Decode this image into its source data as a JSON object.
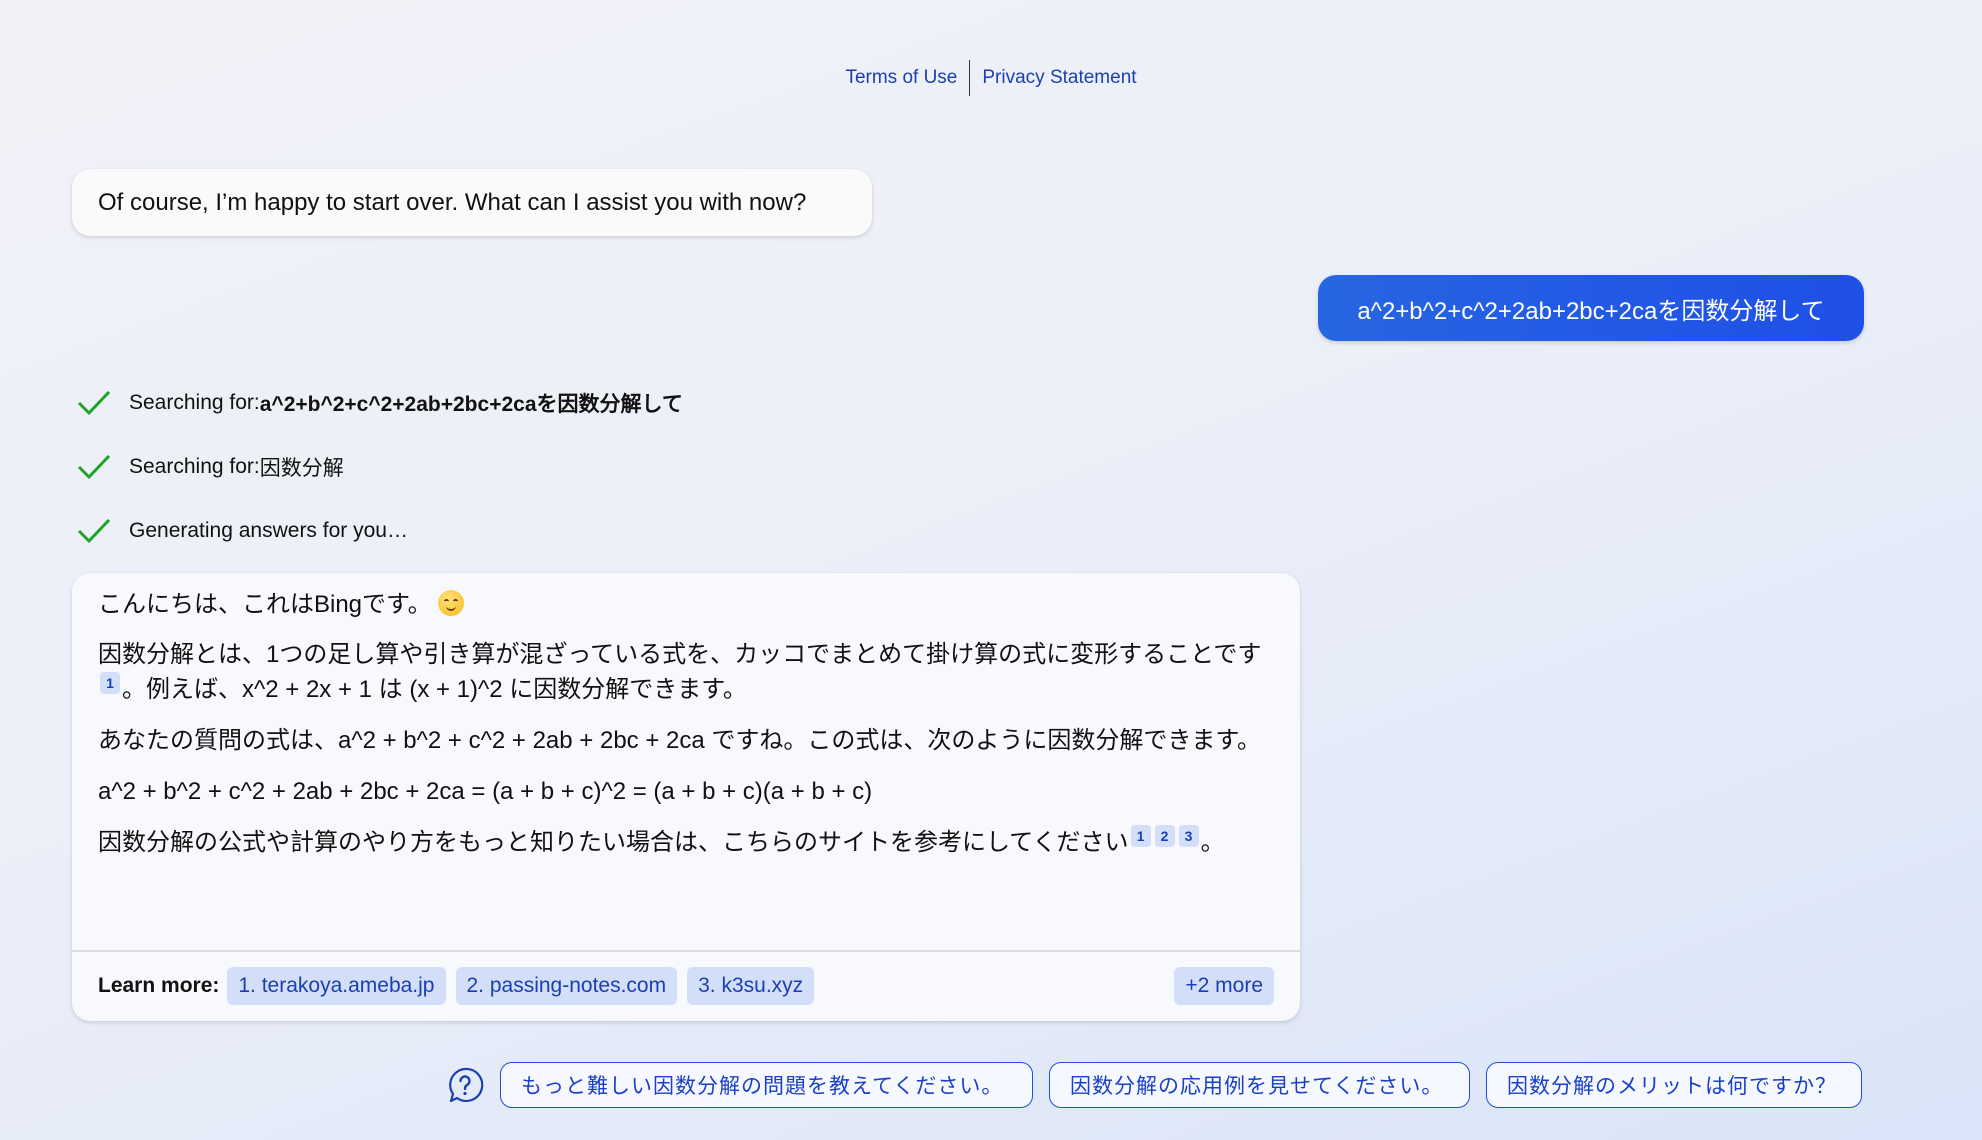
{
  "footer": {
    "links": [
      "Terms of Use",
      "Privacy Statement"
    ]
  },
  "conversation": {
    "bot_message": "Of course, I’m happy to start over. What can I assist you with now?",
    "user_message": "a^2+b^2+c^2+2ab+2bc+2caを因数分解して",
    "status": [
      {
        "prefix": "Searching for: ",
        "query": "a^2+b^2+c^2+2ab+2bc+2caを因数分解して",
        "icon": "check-icon"
      },
      {
        "prefix": "Searching for: ",
        "query": "因数分解",
        "icon": "check-icon"
      },
      {
        "prefix": "Generating answers for you…",
        "query": "",
        "icon": "check-icon"
      }
    ],
    "answer": {
      "greeting": "こんにちは、これはBingです。",
      "greeting_emoji": "smiling-face-emoji",
      "para1_a": "因数分解とは、1つの足し算や引き算が混ざっている式を、カッコでまとめて掛け算の式に変形することです",
      "para1_cite": "1",
      "para1_b": "。例えば、x^2 + 2x + 1 は (x + 1)^2 に因数分解できます。",
      "para2": "あなたの質問の式は、a^2 + b^2 + c^2 + 2ab + 2bc + 2ca ですね。この式は、次のように因数分解できます。",
      "formula": "a^2 + b^2 + c^2 + 2ab + 2bc + 2ca = (a + b + c)^2 = (a + b + c)(a + b + c)",
      "para3": "因数分解の公式や計算のやり方をもっと知りたい場合は、こちらのサイトを参考にしてください",
      "para3_cites": [
        "1",
        "2",
        "3"
      ],
      "para3_end": "。",
      "learn_more_label": "Learn more:",
      "sources": [
        "1. terakoya.ameba.jp",
        "2. passing-notes.com",
        "3. k3su.xyz"
      ],
      "more_label": "+2 more"
    },
    "suggestions": [
      "もっと難しい因数分解の問題を教えてください。",
      "因数分解の応用例を見せてください。",
      "因数分解のメリットは何ですか？"
    ]
  },
  "colors": {
    "accent": "#1e4fe6",
    "link": "#1a3fb0",
    "check": "#1fa32a",
    "chip_bg": "#d3def8"
  }
}
